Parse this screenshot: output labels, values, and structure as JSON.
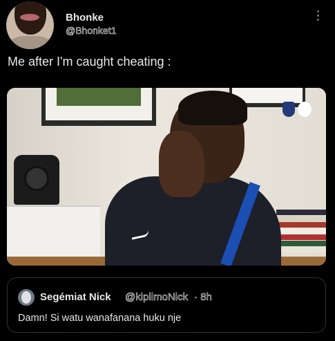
{
  "post": {
    "author_name": "Bhonke",
    "author_handle": "@Bhonket1",
    "text": "Me after I'm caught cheating :"
  },
  "quoted_post": {
    "author_name": "Segémiat Nick",
    "author_handle": "@kiplimoNick",
    "time": "· 8h",
    "text": "Damn! Si watu wanafanana huku nje"
  },
  "icons": {
    "more": "more-vertical-icon"
  }
}
